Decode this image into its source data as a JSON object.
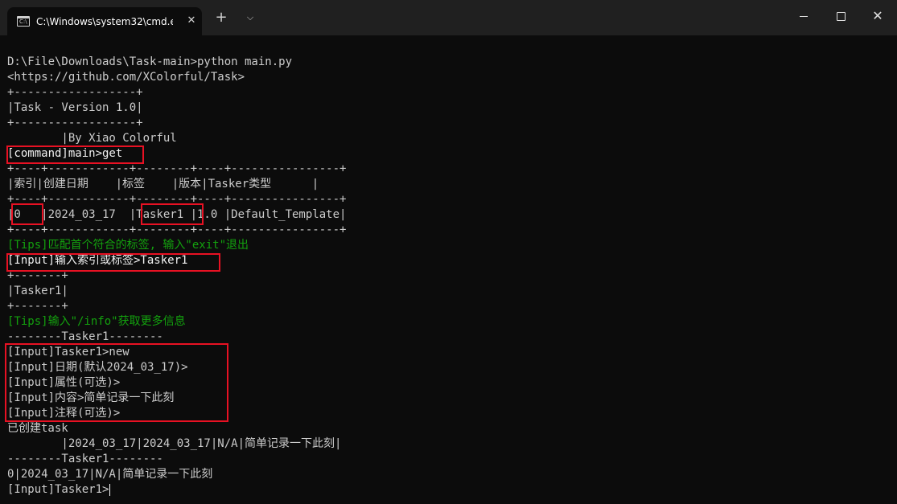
{
  "window": {
    "tab_title": "C:\\Windows\\system32\\cmd.e:",
    "tab_close": "✕",
    "new_tab": "+",
    "tab_dropdown": "⌵",
    "minimize": "",
    "maximize": "",
    "close": "✕"
  },
  "console": {
    "lines": [
      "D:\\File\\Downloads\\Task-main>python main.py",
      "<https://github.com/XColorful/Task>",
      "+------------------+",
      "|Task - Version 1.0|",
      "+------------------+",
      "        |By Xiao Colorful",
      "[command]main>get",
      "+----+------------+--------+----+----------------+",
      "|索引|创建日期    |标签    |版本|Tasker类型      |",
      "+----+------------+--------+----+----------------+",
      "|0   |2024_03_17  |Tasker1 |1.0 |Default_Template|",
      "+----+------------+--------+----+----------------+",
      "[Tips]匹配首个符合的标签, 输入\"exit\"退出",
      "[Input]输入索引或标签>Tasker1",
      "+-------+",
      "|Tasker1|",
      "+-------+",
      "[Tips]输入\"/info\"获取更多信息",
      "--------Tasker1--------",
      "[Input]Tasker1>new",
      "[Input]日期(默认2024_03_17)>",
      "[Input]属性(可选)>",
      "[Input]内容>简单记录一下此刻",
      "[Input]注释(可选)>",
      "已创建task",
      "        |2024_03_17|2024_03_17|N/A|简单记录一下此刻|",
      "--------Tasker1--------",
      "0|2024_03_17|N/A|简单记录一下此刻",
      "[Input]Tasker1>"
    ]
  },
  "colors": {
    "background": "#0c0c0c",
    "text": "#cccccc",
    "tips": "#13a10e",
    "highlight_box": "#e81123",
    "titlebar": "#202020"
  }
}
